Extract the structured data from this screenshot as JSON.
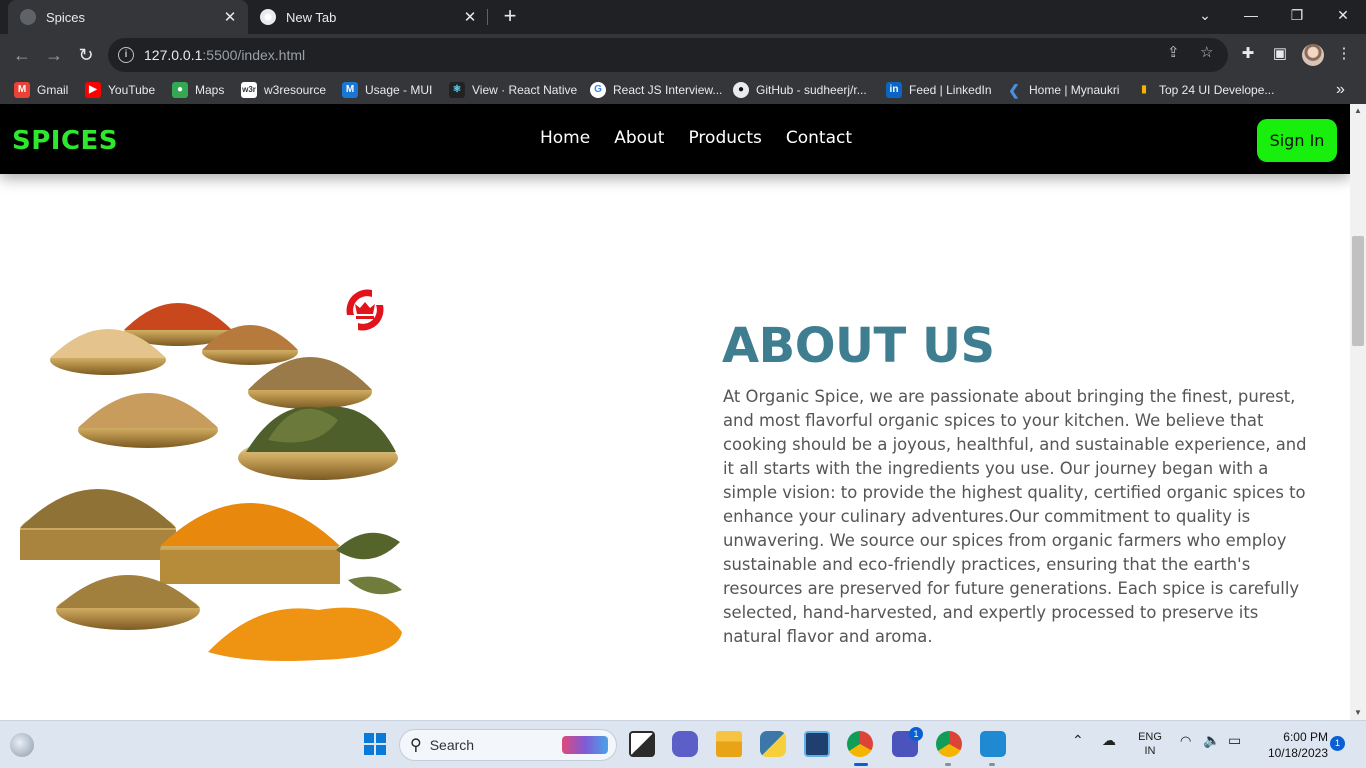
{
  "browser": {
    "tabs": [
      {
        "title": "Spices",
        "active": true
      },
      {
        "title": "New Tab",
        "active": false
      }
    ],
    "url_host": "127.0.0.1",
    "url_rest": ":5500/index.html",
    "bookmarks": [
      {
        "label": "Gmail",
        "icon": "gmail-icon"
      },
      {
        "label": "YouTube",
        "icon": "youtube-icon"
      },
      {
        "label": "Maps",
        "icon": "maps-icon"
      },
      {
        "label": "w3resource",
        "icon": "w3resource-icon"
      },
      {
        "label": "Usage - MUI",
        "icon": "mui-icon"
      },
      {
        "label": "View · React Native",
        "icon": "react-icon"
      },
      {
        "label": "React JS Interview...",
        "icon": "google-icon"
      },
      {
        "label": "GitHub - sudheerj/r...",
        "icon": "github-icon"
      },
      {
        "label": "Feed | LinkedIn",
        "icon": "linkedin-icon"
      },
      {
        "label": "Home | Mynaukri",
        "icon": "naukri-icon"
      },
      {
        "label": "Top 24 UI Develope...",
        "icon": "bookmark-icon"
      }
    ]
  },
  "site": {
    "logo": "SPICES",
    "nav": [
      "Home",
      "About",
      "Products",
      "Contact"
    ],
    "signin": "Sign In",
    "about_title": "ABOUT US",
    "about_text": "At Organic Spice, we are passionate about bringing the finest, purest, and most flavorful organic spices to your kitchen. We believe that cooking should be a joyous, healthful, and sustainable experience, and it all starts with the ingredients you use. Our journey began with a simple vision: to provide the highest quality, certified organic spices to enhance your culinary adventures.Our commitment to quality is unwavering. We source our spices from organic farmers who employ sustainable and eco-friendly practices, ensuring that the earth's resources are preserved for future generations. Each spice is carefully selected, hand-harvested, and expertly processed to preserve its natural flavor and aroma."
  },
  "taskbar": {
    "search_label": "Search",
    "lang_line1": "ENG",
    "lang_line2": "IN",
    "time": "6:00 PM",
    "date": "10/18/2023",
    "notifications": "1",
    "teams_badge": "1"
  },
  "colors": {
    "logo": "#2ee82e",
    "signin_bg": "#18ef0c",
    "about_title": "#3f7d91",
    "body_text": "#555555",
    "header_bg": "#000000"
  }
}
